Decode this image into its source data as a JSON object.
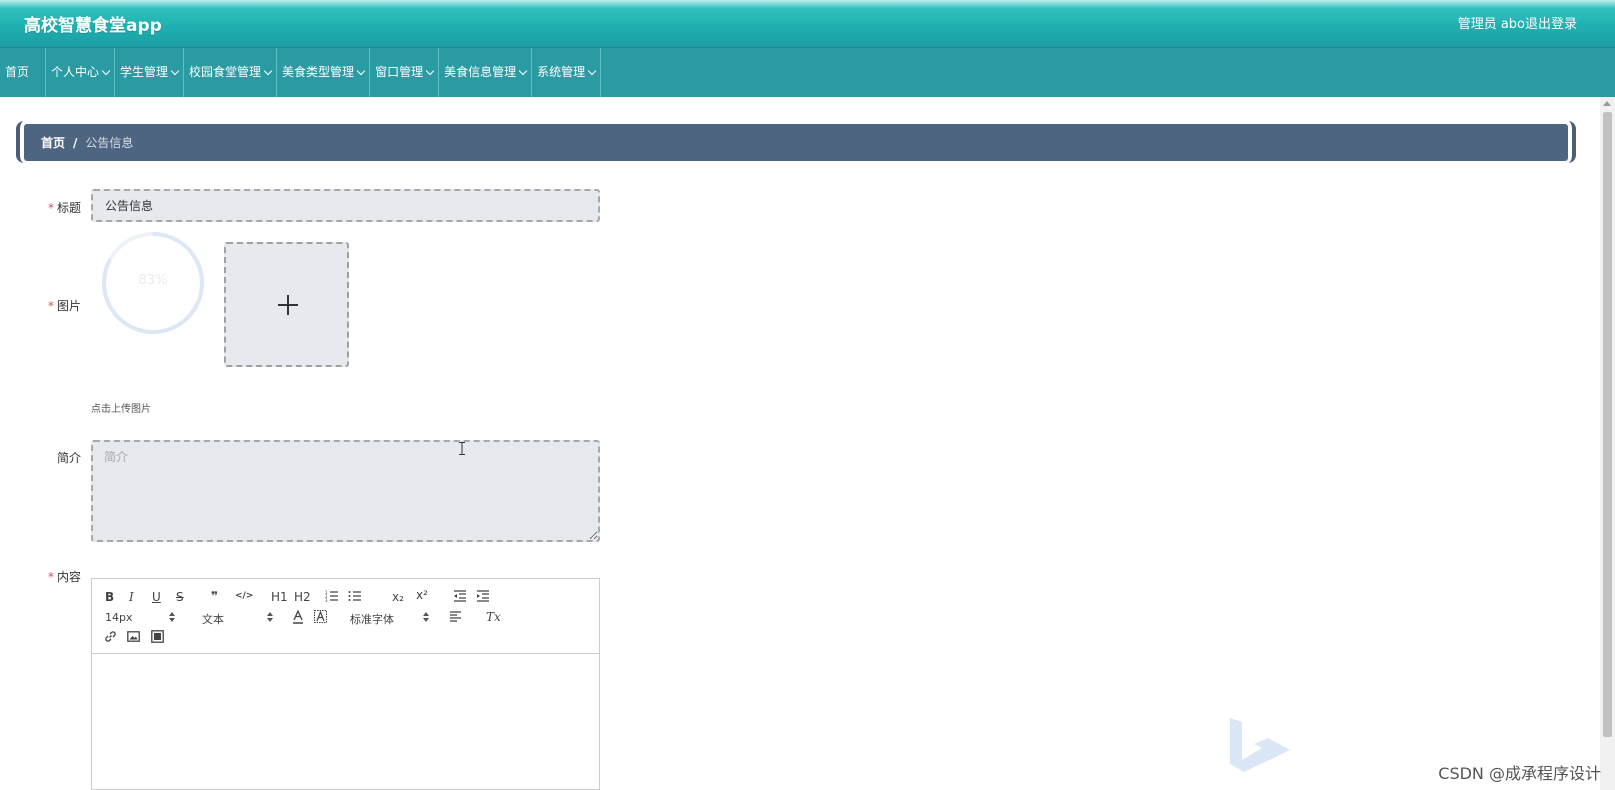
{
  "header": {
    "app_title": "高校智慧食堂app",
    "user": "管理员 abo",
    "logout": "退出登录"
  },
  "nav": {
    "items": [
      {
        "label": "首页",
        "dropdown": false
      },
      {
        "label": "个人中心",
        "dropdown": true
      },
      {
        "label": "学生管理",
        "dropdown": true
      },
      {
        "label": "校园食堂管理",
        "dropdown": true
      },
      {
        "label": "美食类型管理",
        "dropdown": true
      },
      {
        "label": "窗口管理",
        "dropdown": true
      },
      {
        "label": "美食信息管理",
        "dropdown": true
      },
      {
        "label": "系统管理",
        "dropdown": true
      }
    ]
  },
  "breadcrumb": {
    "home": "首页",
    "separator": "/",
    "current": "公告信息"
  },
  "form": {
    "title_label": "标题",
    "title_value": "公告信息",
    "image_label": "图片",
    "upload_progress": "83%",
    "upload_progress_value": 0.83,
    "upload_hint": "点击上传图片",
    "intro_label": "简介",
    "intro_placeholder": "简介",
    "content_label": "内容",
    "required_mark": "*"
  },
  "editor": {
    "bold": "B",
    "italic": "I",
    "underline": "U",
    "strike": "S",
    "blockquote": "❞",
    "code": "</>",
    "h1": "H1",
    "h2": "H2",
    "sub": "x₂",
    "sup": "x²",
    "size": "14px",
    "header_style": "文本",
    "font": "标准字体",
    "clean": "Tx"
  },
  "watermark": "CSDN @成承程序设计",
  "colors": {
    "topbar": "#1fb0b0",
    "navbar": "#2a9aa3",
    "breadcrumb": "#4e6582",
    "required": "#e05050"
  }
}
